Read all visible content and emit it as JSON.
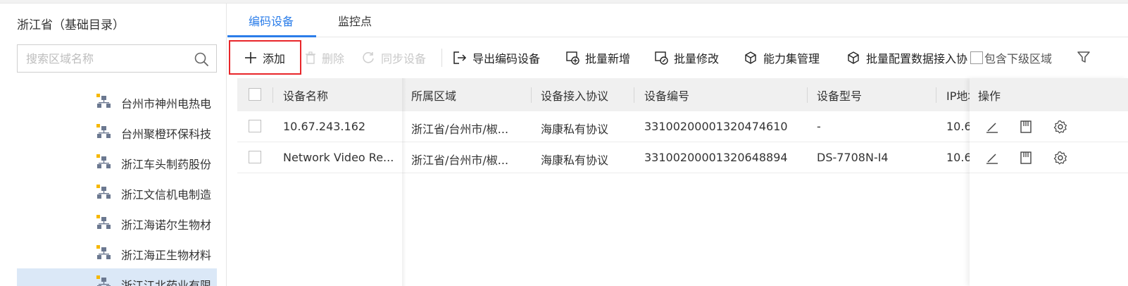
{
  "left_panel": {
    "title": "浙江省（基础目录）",
    "search_placeholder": "搜索区域名称",
    "tree_items": [
      {
        "label": "台州市神州电热电"
      },
      {
        "label": "台州聚橙环保科技"
      },
      {
        "label": "浙江车头制药股份"
      },
      {
        "label": "浙江文信机电制造"
      },
      {
        "label": "浙江海诺尔生物材"
      },
      {
        "label": "浙江海正生物材料"
      },
      {
        "label": "浙江江北药业有限",
        "selected": true
      }
    ]
  },
  "tabs": [
    {
      "label": "编码设备",
      "active": true
    },
    {
      "label": "监控点",
      "active": false
    }
  ],
  "toolbar": {
    "add": "添加",
    "delete": "删除",
    "sync": "同步设备",
    "export": "导出编码设备",
    "batch_add": "批量新增",
    "batch_edit": "批量修改",
    "capability": "能力集管理",
    "batch_config": "批量配置数据接入协议",
    "include_sub": "包含下级区域"
  },
  "table": {
    "columns": [
      "设备名称",
      "所属区域",
      "设备接入协议",
      "设备编号",
      "设备型号",
      "IP地址",
      "操作"
    ],
    "rows": [
      {
        "name": "10.67.243.162",
        "area": "浙江省/台州市/椒...",
        "protocol": "海康私有协议",
        "code": "33100200001320474610",
        "model": "-",
        "ip": "10.6"
      },
      {
        "name": "Network Video Re...",
        "area": "浙江省/台州市/椒...",
        "protocol": "海康私有协议",
        "code": "33100200001320648894",
        "model": "DS-7708N-I4",
        "ip": "10.6"
      }
    ]
  },
  "colors": {
    "accent": "#2b7de9",
    "highlight_box": "#e8262a",
    "selected_row": "#dbe8f7"
  }
}
